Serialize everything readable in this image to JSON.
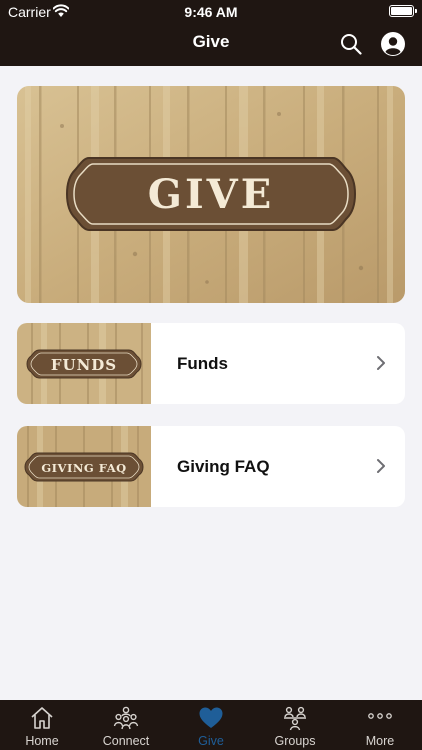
{
  "status_bar": {
    "carrier": "Carrier",
    "time": "9:46 AM"
  },
  "nav": {
    "title": "Give",
    "search_icon": "search-icon",
    "profile_icon": "profile-icon"
  },
  "hero": {
    "sign_text": "GIVE"
  },
  "items": [
    {
      "thumb_text": "FUNDS",
      "label": "Funds"
    },
    {
      "thumb_text": "GIVING FAQ",
      "label": "Giving FAQ"
    }
  ],
  "tabs": [
    {
      "label": "Home",
      "icon": "home-icon"
    },
    {
      "label": "Connect",
      "icon": "people-icon"
    },
    {
      "label": "Give",
      "icon": "heart-icon",
      "active": true
    },
    {
      "label": "Groups",
      "icon": "groups-icon"
    },
    {
      "label": "More",
      "icon": "more-icon"
    }
  ],
  "colors": {
    "bar": "#1f1612",
    "accent": "#1f5e98",
    "background": "#f3f3f7",
    "sign": "#6b4f35"
  }
}
